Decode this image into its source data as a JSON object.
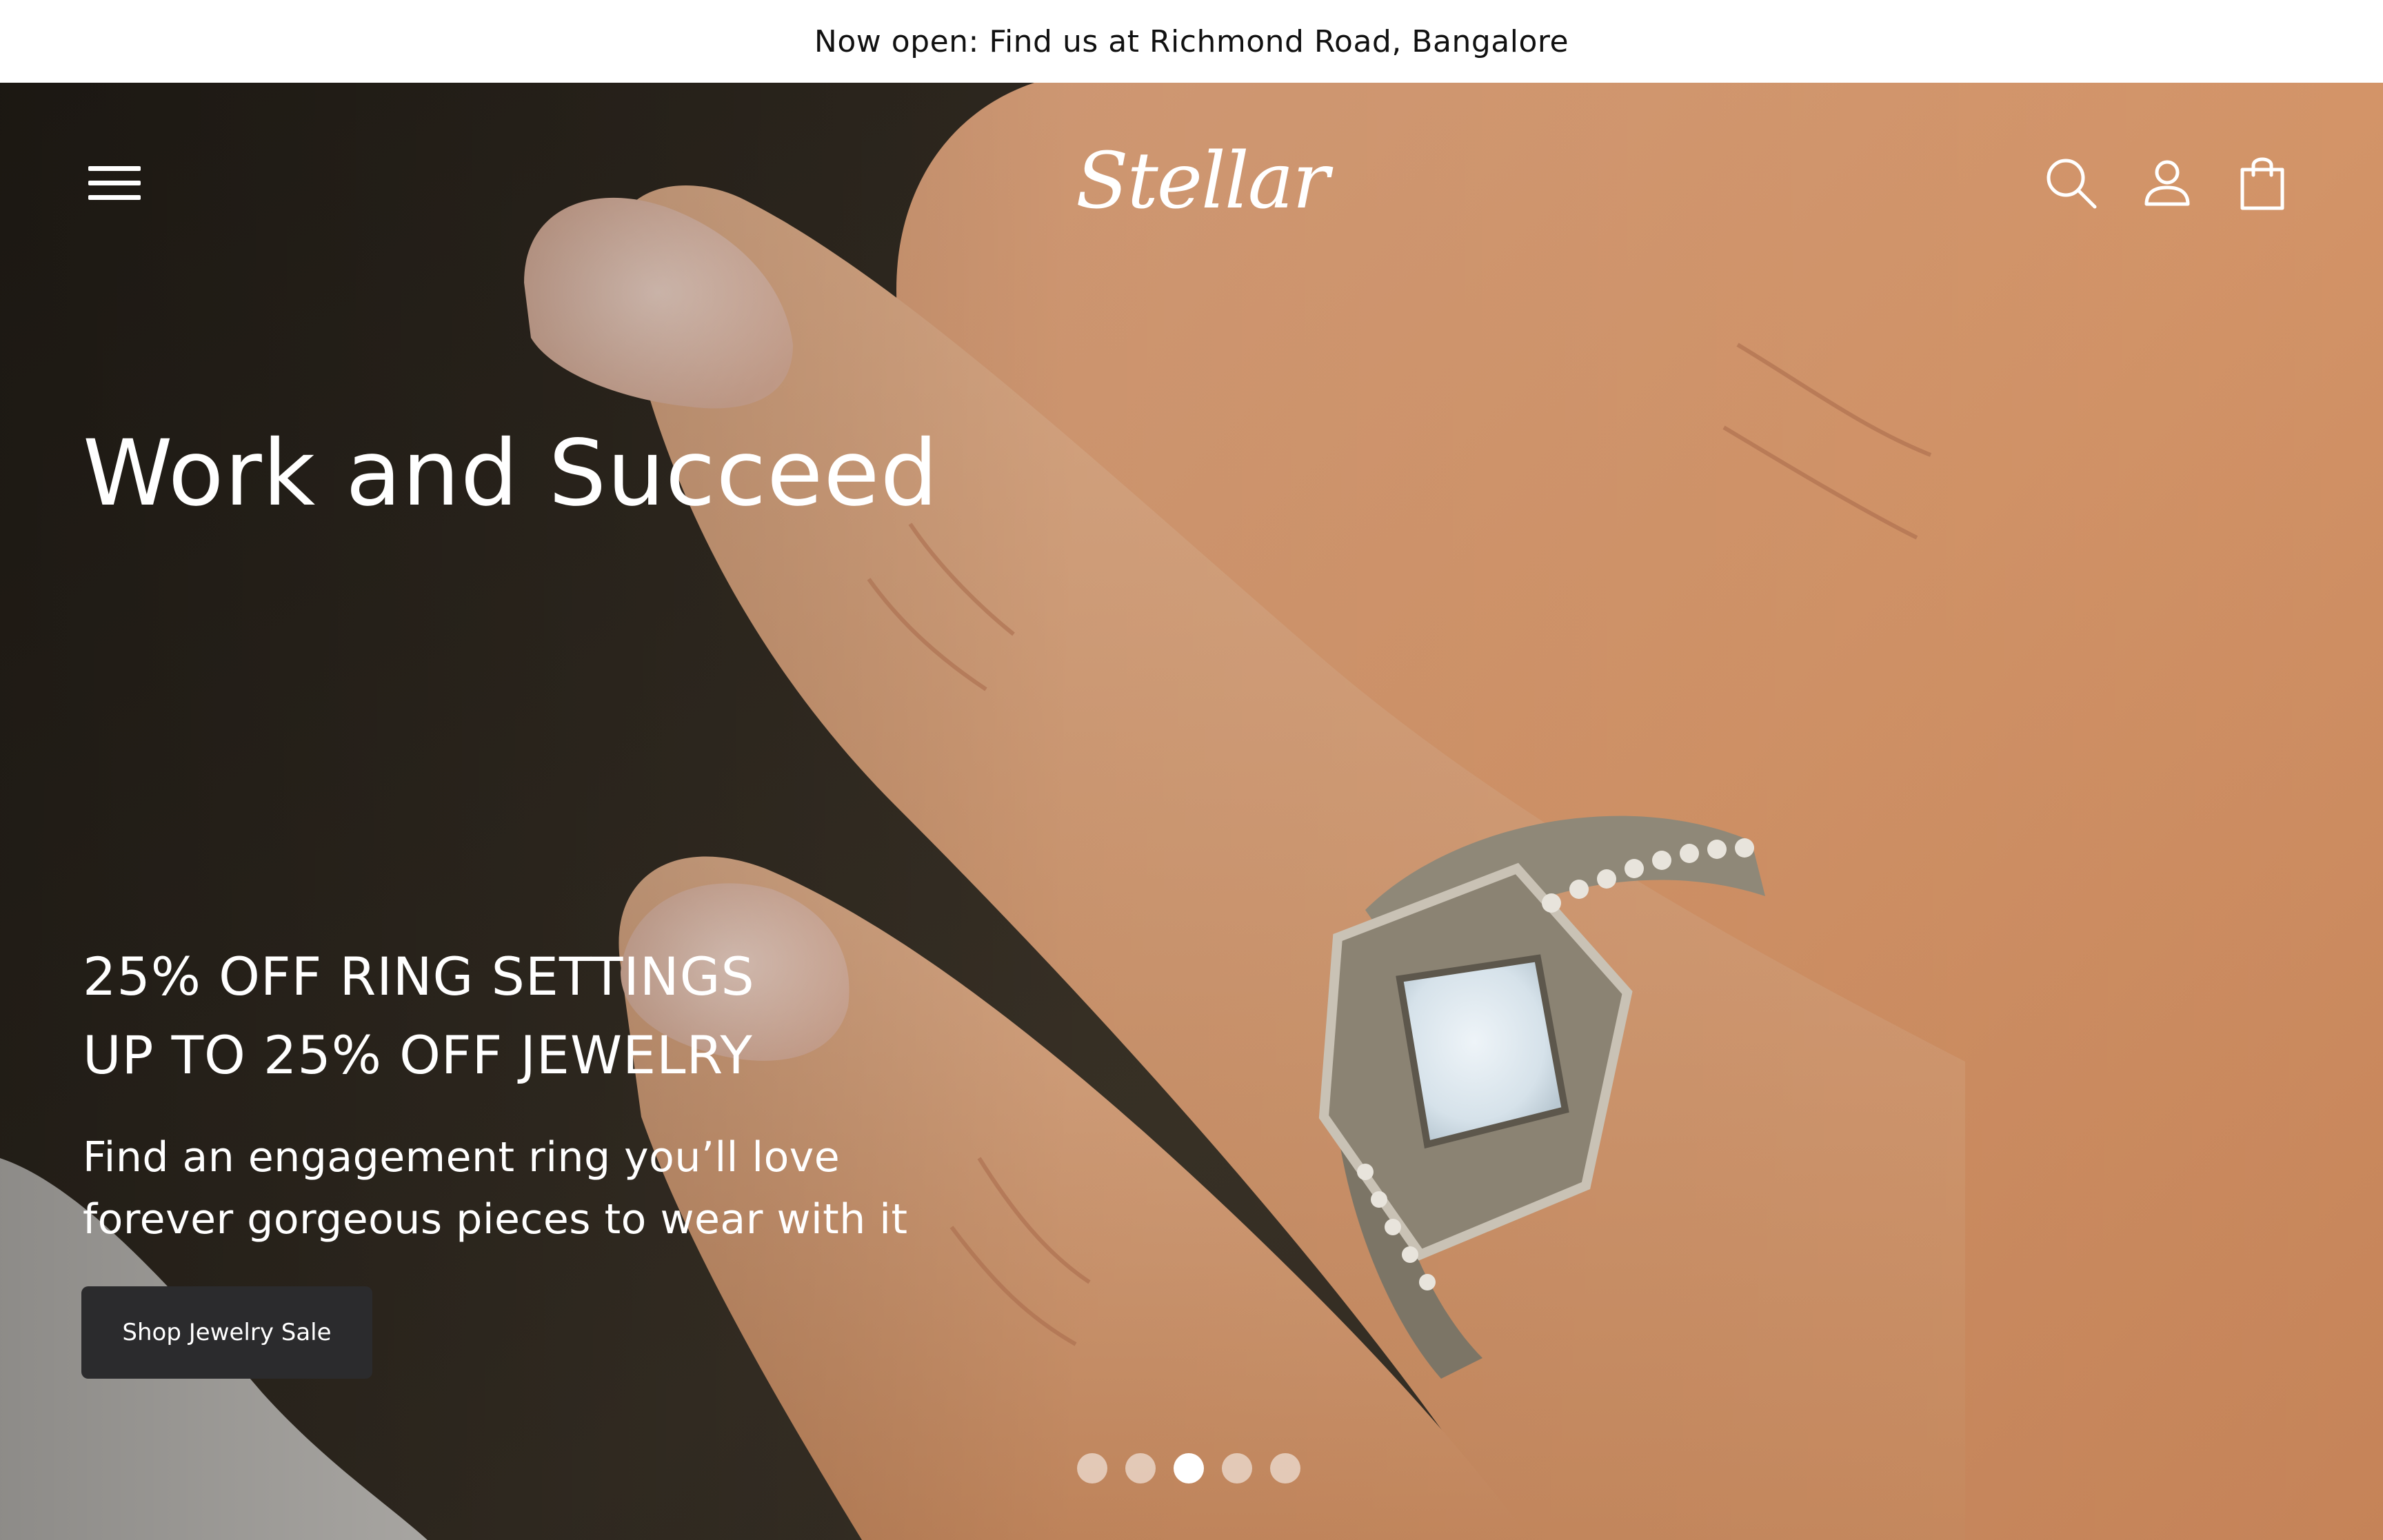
{
  "announcement": {
    "text": "Now open: Find us at Richmond Road, Bangalore"
  },
  "header": {
    "brand": "Stellar",
    "icons": [
      "menu-icon",
      "search-icon",
      "account-icon",
      "cart-icon"
    ]
  },
  "hero": {
    "title": "Work and Succeed",
    "offer_line_1": "25% OFF RING SETTINGS",
    "offer_line_2": "UP TO 25% OFF JEWELRY",
    "subtitle_line_1": "Find an engagement ring you’ll love",
    "subtitle_line_2": "forever gorgeous pieces to wear with it",
    "cta_label": "Shop Jewelry Sale",
    "slides": {
      "count": 5,
      "active_index": 3
    }
  },
  "colors": {
    "text_on_hero": "#ffffff",
    "cta_background": "#2b2b2d",
    "announcement_background": "#ffffff"
  }
}
